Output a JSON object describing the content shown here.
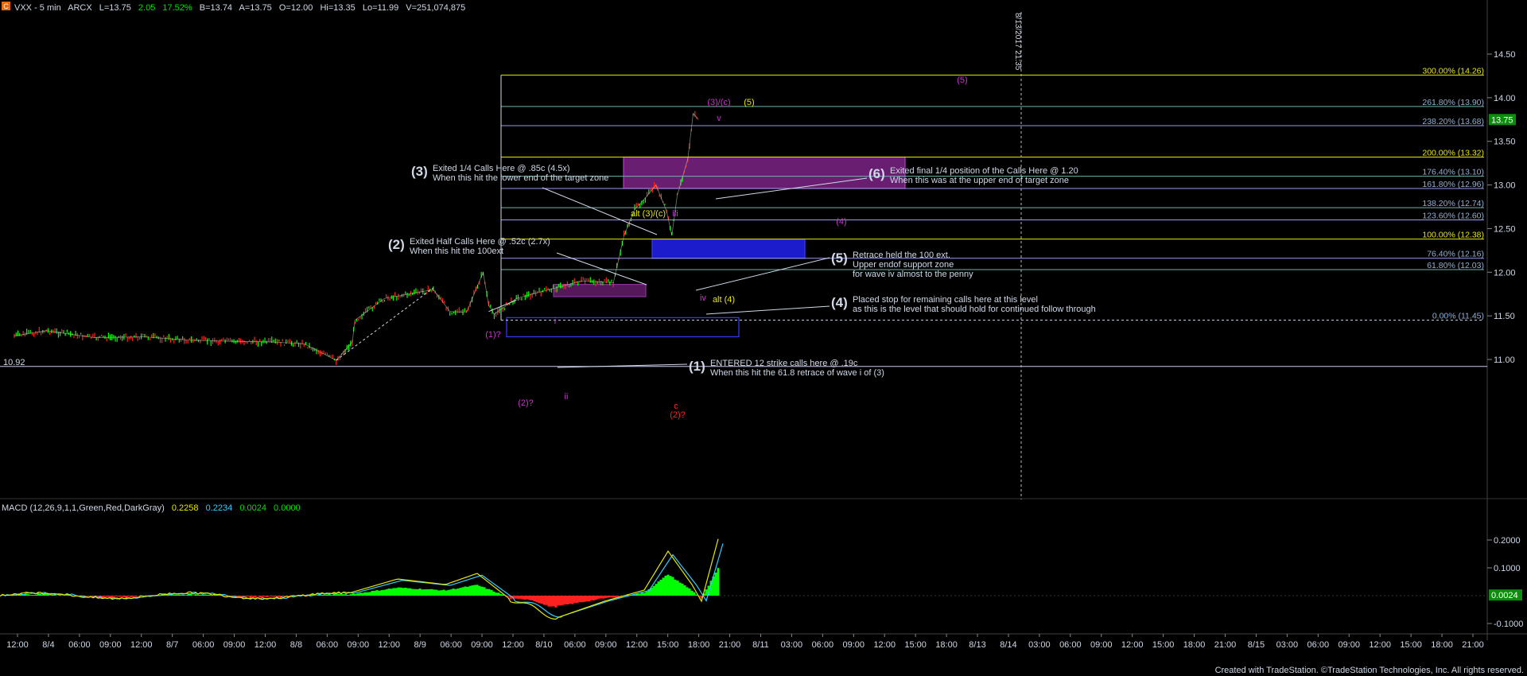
{
  "header": {
    "logo": "C",
    "symbol": "VXX - 5 min",
    "exchange": "ARCX",
    "last": "L=13.75",
    "change": "2.05",
    "change_pct": "17.52%",
    "bid": "B=13.74",
    "ask": "A=13.75",
    "open": "O=12.00",
    "high": "Hi=13.35",
    "low": "Lo=11.99",
    "volume": "V=251,074,875"
  },
  "macd_header": {
    "label": "MACD (12,26,9,1,1,Green,Red,DarkGray)",
    "v1": "0.2258",
    "v2": "0.2234",
    "v3": "0.0024",
    "v4": "0.0000"
  },
  "footer": "Created with TradeStation. ©TradeStation Technologies, Inc. All rights reserved.",
  "colors": {
    "up": "#00ff00",
    "down": "#ff2020",
    "yellow": "#e6e600",
    "magenta": "#cc33cc",
    "blue": "#1a1acc",
    "label": "#cfd8e6"
  },
  "chart_data": {
    "type": "line",
    "price_axis": {
      "ylim": [
        10.7,
        14.8
      ],
      "ticks": [
        "14.50",
        "14.00",
        "13.50",
        "13.00",
        "12.50",
        "12.00",
        "11.50",
        "11.00"
      ],
      "last_price_tag": "13.75",
      "left_level_label": "10.92"
    },
    "macd_axis": {
      "ylim": [
        -0.13,
        0.29
      ],
      "ticks": [
        "0.2000",
        "0.1000",
        "-0.1000"
      ],
      "last_tag": "0.0024"
    },
    "time_axis": [
      "12:00",
      "8/4",
      "06:00",
      "09:00",
      "12:00",
      "8/7",
      "06:00",
      "09:00",
      "12:00",
      "8/8",
      "06:00",
      "09:00",
      "12:00",
      "8/9",
      "06:00",
      "09:00",
      "12:00",
      "8/10",
      "06:00",
      "09:00",
      "12:00",
      "15:00",
      "18:00",
      "21:00",
      "8/11",
      "03:00",
      "06:00",
      "09:00",
      "12:00",
      "15:00",
      "18:00",
      "8/13",
      "8/14",
      "03:00",
      "06:00",
      "09:00",
      "12:00",
      "15:00",
      "18:00",
      "21:00",
      "8/15",
      "03:00",
      "06:00",
      "09:00",
      "12:00",
      "15:00",
      "18:00",
      "21:00"
    ],
    "date_marker": "8/13/2017 21:35",
    "fib_levels": [
      {
        "label": "300.00% (14.26)",
        "value": 14.26
      },
      {
        "label": "261.80% (13.90)",
        "value": 13.9
      },
      {
        "label": "238.20% (13.68)",
        "value": 13.68
      },
      {
        "label": "200.00% (13.32)",
        "value": 13.32
      },
      {
        "label": "176.40% (13.10)",
        "value": 13.1
      },
      {
        "label": "161.80% (12.96)",
        "value": 12.96
      },
      {
        "label": "138.20% (12.74)",
        "value": 12.74
      },
      {
        "label": "123.60% (12.60)",
        "value": 12.6
      },
      {
        "label": "100.00% (12.38)",
        "value": 12.38
      },
      {
        "label": "76.40% (12.16)",
        "value": 12.16
      },
      {
        "label": "61.80% (12.03)",
        "value": 12.03
      },
      {
        "label": "0.00% (11.45)",
        "value": 11.45
      }
    ],
    "price_series": [
      [
        "8/3 12:00",
        11.27
      ],
      [
        "8/4 03:00",
        11.33
      ],
      [
        "8/4 12:00",
        11.25
      ],
      [
        "8/4 21:00",
        11.26
      ],
      [
        "8/7 06:00",
        11.22
      ],
      [
        "8/7 12:00",
        11.21
      ],
      [
        "8/7 21:00",
        11.2
      ],
      [
        "8/8 03:00",
        11.18
      ],
      [
        "8/8 09:00",
        10.99
      ],
      [
        "8/8 12:00",
        11.2
      ],
      [
        "8/8 12:30",
        11.45
      ],
      [
        "8/8 18:00",
        11.7
      ],
      [
        "8/9 03:00",
        11.8
      ],
      [
        "8/9 06:00",
        11.55
      ],
      [
        "8/9 09:00",
        11.54
      ],
      [
        "8/9 12:00",
        12.0
      ],
      [
        "8/9 13:00",
        11.62
      ],
      [
        "8/9 14:00",
        11.52
      ],
      [
        "8/9 18:00",
        11.7
      ],
      [
        "8/10 03:00",
        11.9
      ],
      [
        "8/10 06:00",
        11.88
      ],
      [
        "8/10 07:00",
        12.42
      ],
      [
        "8/10 08:00",
        12.72
      ],
      [
        "8/10 09:00",
        12.85
      ],
      [
        "8/10 10:00",
        13.0
      ],
      [
        "8/10 11:00",
        12.7
      ],
      [
        "8/10 11:30",
        12.42
      ],
      [
        "8/10 12:00",
        12.88
      ],
      [
        "8/10 13:00",
        13.3
      ],
      [
        "8/10 13:30",
        13.82
      ],
      [
        "8/10 14:00",
        13.75
      ]
    ],
    "zones": [
      {
        "name": "target-zone",
        "color": "magenta",
        "price_range": [
          12.96,
          13.32
        ]
      },
      {
        "name": "support-zone",
        "color": "blue",
        "price_range": [
          12.16,
          12.38
        ]
      },
      {
        "name": "wave-ii-zone",
        "color": "magenta",
        "price_range": [
          11.72,
          11.86
        ]
      },
      {
        "name": "low-zone",
        "color": "blue",
        "price_range": [
          11.26,
          11.48
        ]
      }
    ],
    "wave_labels": [
      {
        "text": "(5)",
        "color": "magenta"
      },
      {
        "text": "(3)/(c)",
        "color": "magenta"
      },
      {
        "text": "(5)",
        "color": "yellow"
      },
      {
        "text": "v",
        "color": "magenta"
      },
      {
        "text": "alt (3)/(c)",
        "color": "yellow"
      },
      {
        "text": "iii",
        "color": "magenta"
      },
      {
        "text": "(4)",
        "color": "magenta"
      },
      {
        "text": "iv",
        "color": "magenta"
      },
      {
        "text": "alt (4)",
        "color": "yellow"
      },
      {
        "text": "(1)?",
        "color": "magenta"
      },
      {
        "text": "i",
        "color": "magenta"
      },
      {
        "text": "ii",
        "color": "magenta"
      },
      {
        "text": "(2)?",
        "color": "magenta"
      },
      {
        "text": "c",
        "color": "red"
      },
      {
        "text": "(2)?",
        "color": "red"
      }
    ],
    "annotations": [
      {
        "num": "(1)",
        "line1": "ENTERED 12 strike calls here @ .19c",
        "line2": "When this hit the 61.8 retrace of wave i of (3)"
      },
      {
        "num": "(2)",
        "line1": "Exited Half Calls Here @ .52c (2.7x)",
        "line2": "When this hit the 100ext"
      },
      {
        "num": "(3)",
        "line1": "Exited 1/4 Calls Here @ .85c (4.5x)",
        "line2": "When this hit the lower end of the target zone"
      },
      {
        "num": "(4)",
        "line1": "Placed stop for remaining calls here at this level",
        "line2": "as this is the level that should hold for continued follow through"
      },
      {
        "num": "(5)",
        "line1": "Retrace held the 100 ext.",
        "line2": "Upper endof support zone",
        "line3": "for wave iv almost to the penny"
      },
      {
        "num": "(6)",
        "line1": "Exited final 1/4 position of the Calls Here @ 1.20",
        "line2": "When this was at the upper end of target zone"
      }
    ]
  }
}
